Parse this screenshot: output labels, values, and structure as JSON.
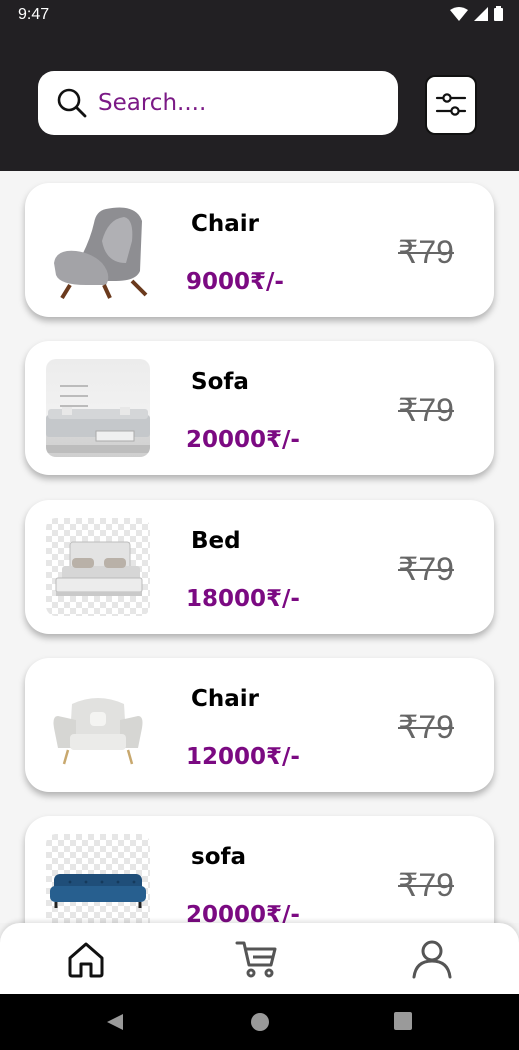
{
  "status_bar": {
    "time": "9:47"
  },
  "search": {
    "placeholder": "Search...."
  },
  "products": [
    {
      "name": "Chair",
      "price": "9000₹/-",
      "old_price": "₹79"
    },
    {
      "name": "Sofa",
      "price": "20000₹/-",
      "old_price": "₹79"
    },
    {
      "name": "Bed",
      "price": "18000₹/-",
      "old_price": "₹79"
    },
    {
      "name": "Chair",
      "price": "12000₹/-",
      "old_price": "₹79"
    },
    {
      "name": "sofa",
      "price": "20000₹/-",
      "old_price": "₹79"
    }
  ],
  "bottom_nav": {
    "items": [
      "home-icon",
      "cart-icon",
      "profile-icon"
    ],
    "active": "home-icon"
  },
  "colors": {
    "header_bg": "#222023",
    "accent": "#7b0a82",
    "strike_price": "#666666"
  }
}
